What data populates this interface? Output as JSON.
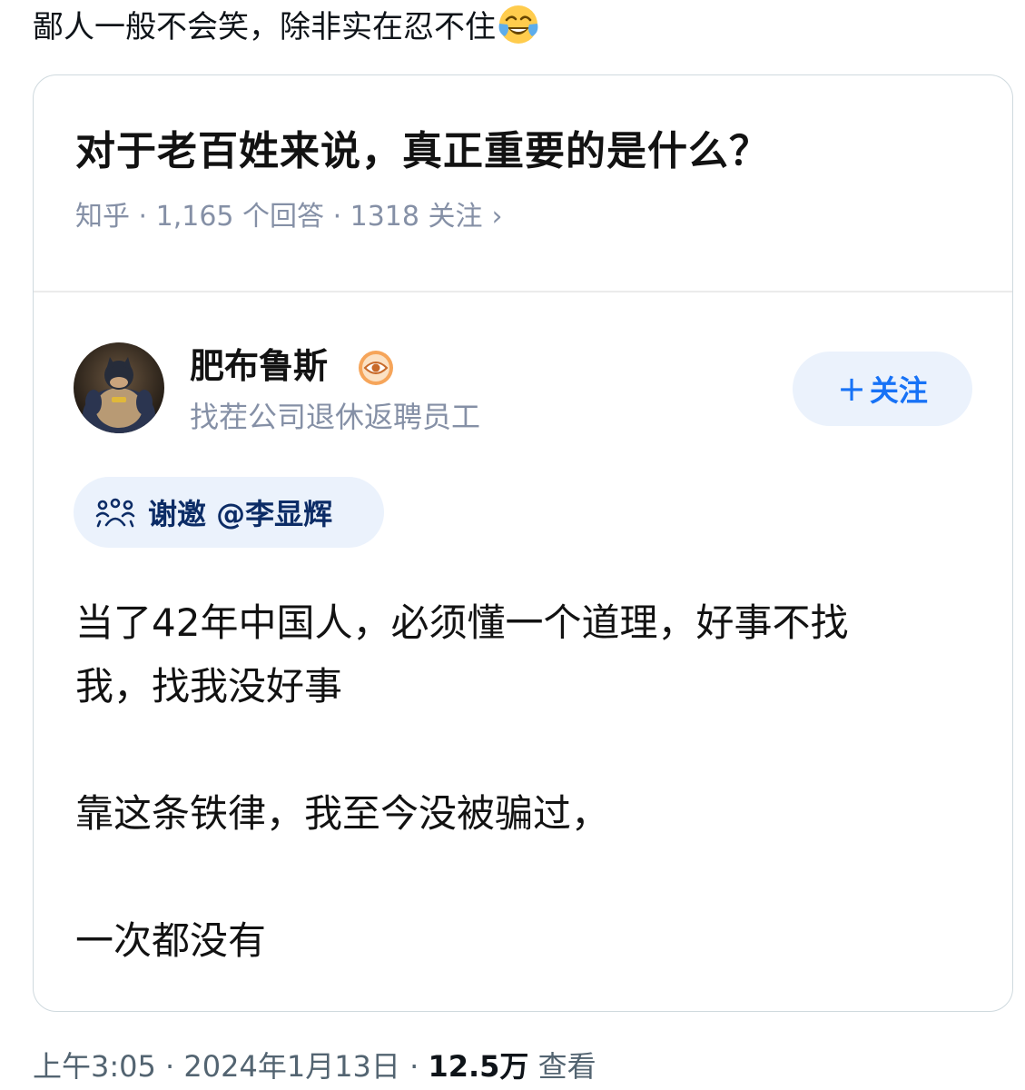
{
  "tweet": {
    "text": "鄙人一般不会笑，除非实在忍不住",
    "emoji_icon": "face-with-tears-of-joy-icon"
  },
  "card": {
    "question_title": "对于老百姓来说，真正重要的是什么？",
    "question_meta": "知乎 · 1,165 个回答 · 1318 关注",
    "meta_chevron": "›",
    "author": {
      "name": "肥布鲁斯",
      "badge_icon": "eye-badge-icon",
      "bio": "找茬公司退休返聘员工"
    },
    "follow_button": {
      "plus": "+",
      "label": "关注"
    },
    "invite": {
      "icon": "invite-people-icon",
      "label": "谢邀 @李显辉"
    },
    "answer_lines": [
      "当了42年中国人，必须懂一个道理，好事不找",
      "我，找我没好事",
      "靠这条铁律，我至今没被骗过，",
      "一次都没有"
    ]
  },
  "footer": {
    "time": "上午3:05",
    "date": "2024年1月13日",
    "views_count": "12.5万",
    "views_label": "查看"
  },
  "colors": {
    "zhihu_blue": "#1772f6",
    "pill_bg": "#ebf2fc",
    "meta_gray": "#8590a6",
    "card_border": "#cfd9de"
  }
}
